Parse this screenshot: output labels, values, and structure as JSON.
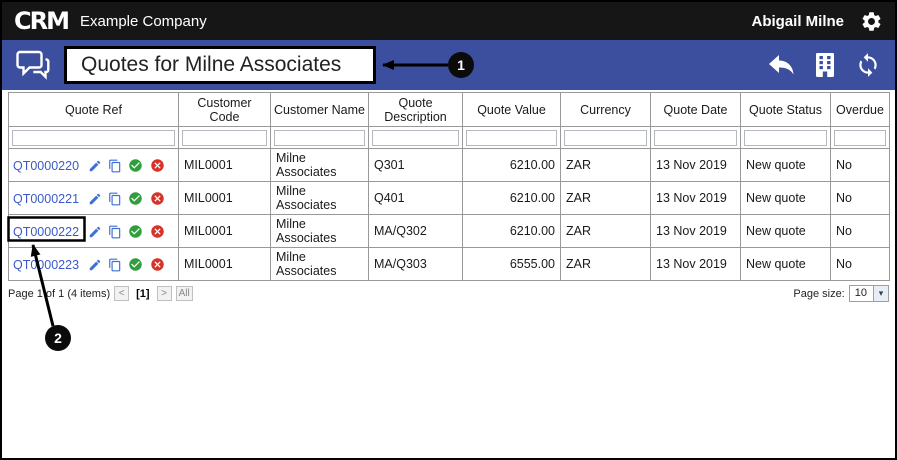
{
  "topbar": {
    "logo": "CRM",
    "company": "Example Company",
    "user": "Abigail Milne"
  },
  "toolbar": {
    "title": "Quotes for Milne Associates"
  },
  "table": {
    "columns": [
      "Quote Ref",
      "Customer Code",
      "Customer Name",
      "Quote Description",
      "Quote Value",
      "Currency",
      "Quote Date",
      "Quote Status",
      "Overdue"
    ],
    "rows": [
      {
        "ref": "QT0000220",
        "code": "MIL0001",
        "name": "Milne Associates",
        "desc": "Q301",
        "value": "6210.00",
        "currency": "ZAR",
        "date": "13 Nov 2019",
        "status": "New quote",
        "overdue": "No"
      },
      {
        "ref": "QT0000221",
        "code": "MIL0001",
        "name": "Milne Associates",
        "desc": "Q401",
        "value": "6210.00",
        "currency": "ZAR",
        "date": "13 Nov 2019",
        "status": "New quote",
        "overdue": "No"
      },
      {
        "ref": "QT0000222",
        "code": "MIL0001",
        "name": "Milne Associates",
        "desc": "MA/Q302",
        "value": "6210.00",
        "currency": "ZAR",
        "date": "13 Nov 2019",
        "status": "New quote",
        "overdue": "No"
      },
      {
        "ref": "QT0000223",
        "code": "MIL0001",
        "name": "Milne Associates",
        "desc": "MA/Q303",
        "value": "6555.00",
        "currency": "ZAR",
        "date": "13 Nov 2019",
        "status": "New quote",
        "overdue": "No"
      }
    ]
  },
  "pager": {
    "info": "Page 1 of 1 (4 items)",
    "prev": "<",
    "current": "[1]",
    "next": ">",
    "all": "All",
    "page_size_label": "Page size:",
    "page_size": "10"
  },
  "annotations": {
    "badge1": "1",
    "badge2": "2"
  },
  "colors": {
    "topbar": "#161616",
    "toolbar_blue": "#3b4f9e",
    "link_blue": "#3a5bc7",
    "check_green": "#2e9f3c",
    "cancel_red": "#d63229"
  }
}
